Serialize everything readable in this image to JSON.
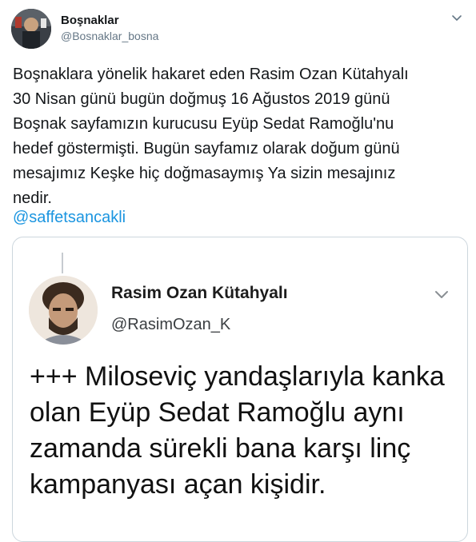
{
  "tweet": {
    "display_name": "Boşnaklar",
    "handle": "@Bosnaklar_bosna",
    "text": "Boşnaklara yönelik hakaret eden  Rasim Ozan Kütahyalı\n30 Nisan günü bugün doğmuş 16 Ağustos 2019 günü\nBoşnak  sayfamızın kurucusu Eyüp Sedat Ramoğlu'nu\nhedef göstermişti. Bugün sayfamız olarak doğum günü\nmesajımız Keşke hiç doğmasaymış Ya sizin mesajınız\nnedir.",
    "mention": "@saffetsancakli",
    "caret_icon": "chevron-down-icon"
  },
  "quoted": {
    "display_name": "Rasim Ozan Kütahyalı",
    "handle": "@RasimOzan_K",
    "text": "+++ Miloseviç yandaşlarıyla kanka\nolan Eyüp Sedat Ramoğlu aynı\nzamanda sürekli bana karşı linç\nkampanyası açan kişidir.",
    "caret_icon": "chevron-down-icon"
  },
  "colors": {
    "link": "#1b95e0",
    "secondary_text": "#657786",
    "border": "#ccd6dd"
  }
}
